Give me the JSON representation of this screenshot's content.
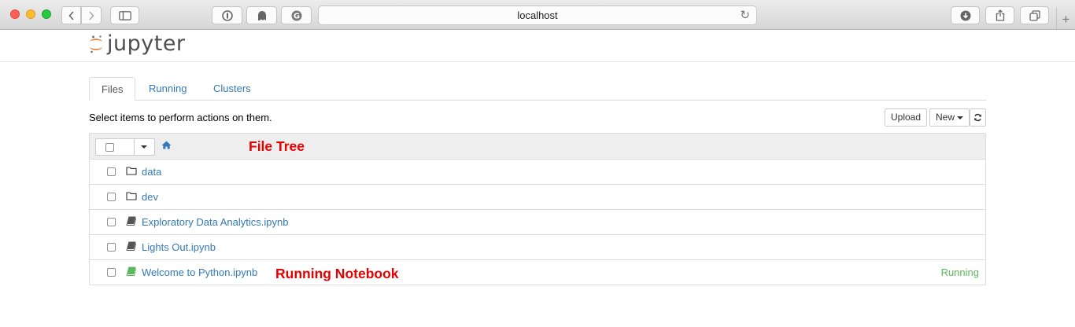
{
  "browser": {
    "url": "localhost"
  },
  "app": {
    "logo_text": "jupyter"
  },
  "tabs": [
    {
      "label": "Files",
      "active": true
    },
    {
      "label": "Running",
      "active": false
    },
    {
      "label": "Clusters",
      "active": false
    }
  ],
  "toolbar": {
    "hint": "Select items to perform actions on them.",
    "upload_label": "Upload",
    "new_label": "New"
  },
  "files": [
    {
      "name": "data",
      "type": "folder",
      "status": ""
    },
    {
      "name": "dev",
      "type": "folder",
      "status": ""
    },
    {
      "name": "Exploratory Data Analytics.ipynb",
      "type": "notebook",
      "status": ""
    },
    {
      "name": "Lights Out.ipynb",
      "type": "notebook",
      "status": ""
    },
    {
      "name": "Welcome to Python.ipynb",
      "type": "notebook-running",
      "status": "Running"
    }
  ],
  "annotations": {
    "file_tree": "File Tree",
    "running_notebook": "Running Notebook"
  },
  "colors": {
    "link": "#337ab7",
    "running": "#5cb85c",
    "annotation": "#e60000",
    "jupyter_orange": "#f37726"
  }
}
